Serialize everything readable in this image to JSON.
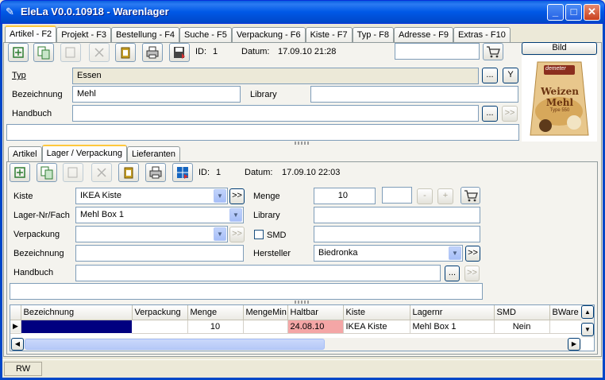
{
  "window": {
    "title": "EleLa V0.0.10918  - Warenlager"
  },
  "main_tabs": [
    "Artikel - F2",
    "Projekt - F3",
    "Bestellung - F4",
    "Suche - F5",
    "Verpackung - F6",
    "Kiste - F7",
    "Typ - F8",
    "Adresse - F9",
    "Extras - F10"
  ],
  "top": {
    "id_label": "ID:",
    "id_value": "1",
    "datum_label": "Datum:",
    "datum_value": "17.09.10 21:28",
    "search_value": "",
    "bild_label": "Bild",
    "typ_label": "Typ",
    "typ_value": "Essen",
    "dots": "...",
    "y_btn": "Y",
    "bez_label": "Bezeichnung",
    "bez_value": "Mehl",
    "library_label": "Library",
    "library_value": "",
    "handbuch_label": "Handbuch",
    "handbuch_value": "",
    "arrow_btn": ">>",
    "notes_value": ""
  },
  "product_image": {
    "brand": "demeter",
    "line1": "Weizen",
    "line2": "Mehl",
    "line3": "Type 550"
  },
  "sub_tabs": [
    "Artikel",
    "Lager / Verpackung",
    "Lieferanten"
  ],
  "lager": {
    "id_label": "ID:",
    "id_value": "1",
    "datum_label": "Datum:",
    "datum_value": "17.09.10 22:03",
    "kiste_label": "Kiste",
    "kiste_value": "IKEA Kiste",
    "lagernr_label": "Lager-Nr/Fach",
    "lagernr_value": "Mehl Box 1",
    "verpackung_label": "Verpackung",
    "verpackung_value": "",
    "bez_label": "Bezeichnung",
    "bez_value": "",
    "handbuch_label": "Handbuch",
    "handbuch_value": "",
    "menge_label": "Menge",
    "menge_value": "10",
    "step_value": "",
    "minus": "-",
    "plus": "+",
    "library_label": "Library",
    "library_value": "",
    "smd_label": "SMD",
    "smd_value": "",
    "hersteller_label": "Hersteller",
    "hersteller_value": "Biedronka",
    "arrow_btn": ">>",
    "dots": "...",
    "notes_value": ""
  },
  "grid": {
    "columns": [
      "Bezeichnung",
      "Verpackung",
      "Menge",
      "MengeMin",
      "Haltbar",
      "Kiste",
      "Lagernr",
      "SMD",
      "BWare"
    ],
    "rows": [
      [
        "",
        "",
        "10",
        "",
        "24.08.10",
        "IKEA Kiste",
        "Mehl Box 1",
        "Nein",
        ""
      ]
    ]
  },
  "status": {
    "mode": "RW"
  },
  "colors": {
    "titlebar": "#0054E3",
    "haltbar_expired": "#F4A6A6",
    "selected_cell": "#000080"
  }
}
